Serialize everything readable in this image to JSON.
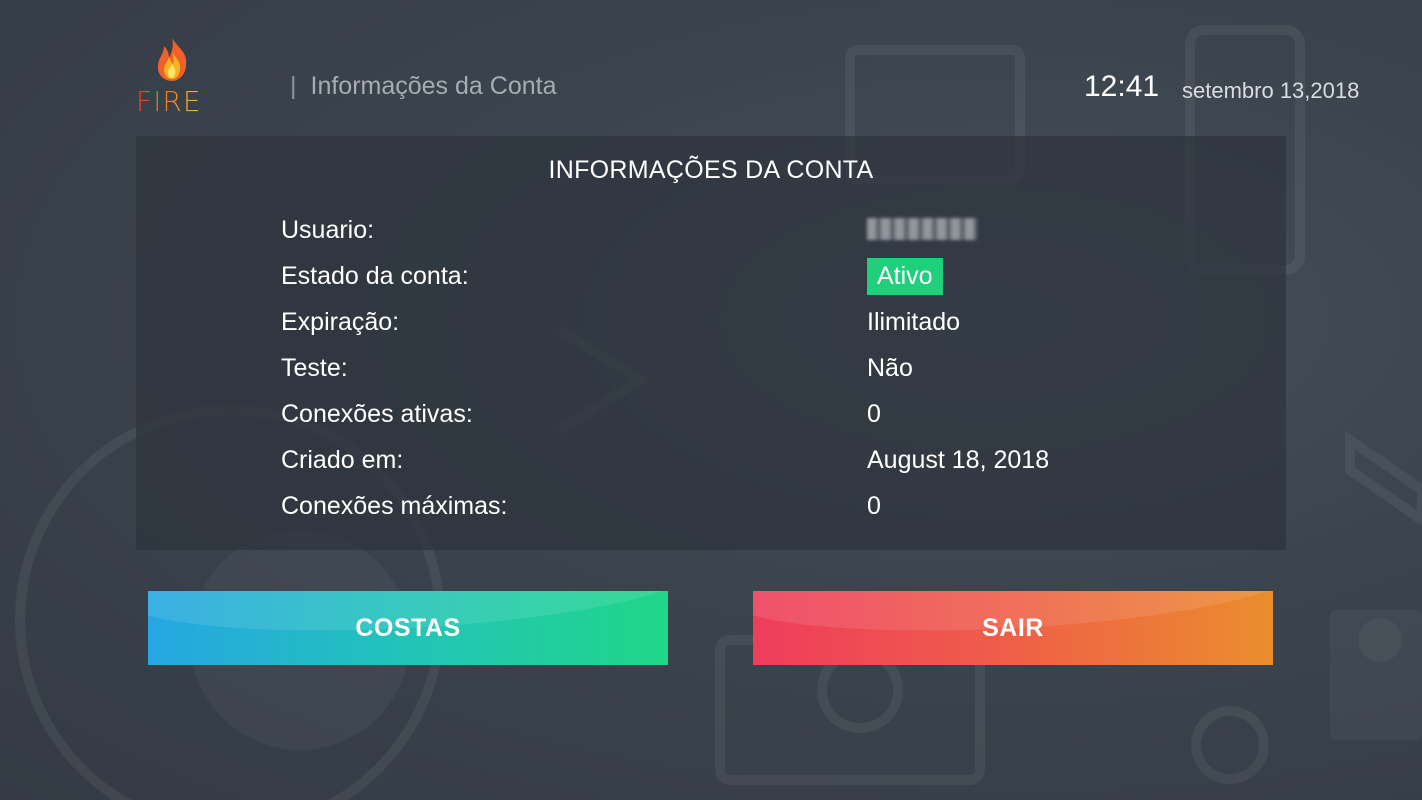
{
  "header": {
    "logo_text": "FIRE",
    "separator": "|",
    "title": "Informações da Conta",
    "time": "12:41",
    "date": "setembro 13,2018"
  },
  "panel": {
    "title": "INFORMAÇÕES DA CONTA",
    "rows": [
      {
        "label": "Usuario:",
        "value": ""
      },
      {
        "label": "Estado da conta:",
        "value": "Ativo"
      },
      {
        "label": "Expiração:",
        "value": "Ilimitado"
      },
      {
        "label": "Teste:",
        "value": "Não"
      },
      {
        "label": "Conexões ativas:",
        "value": "0"
      },
      {
        "label": "Criado em:",
        "value": "August 18, 2018"
      },
      {
        "label": "Conexões máximas:",
        "value": "0"
      }
    ]
  },
  "buttons": {
    "back": "COSTAS",
    "exit": "SAIR"
  },
  "colors": {
    "status_active": "#1fcf7c",
    "back_start": "#25a6e2",
    "back_end": "#20d688",
    "exit_start": "#ef3d5c",
    "exit_end": "#eb8d2e"
  }
}
